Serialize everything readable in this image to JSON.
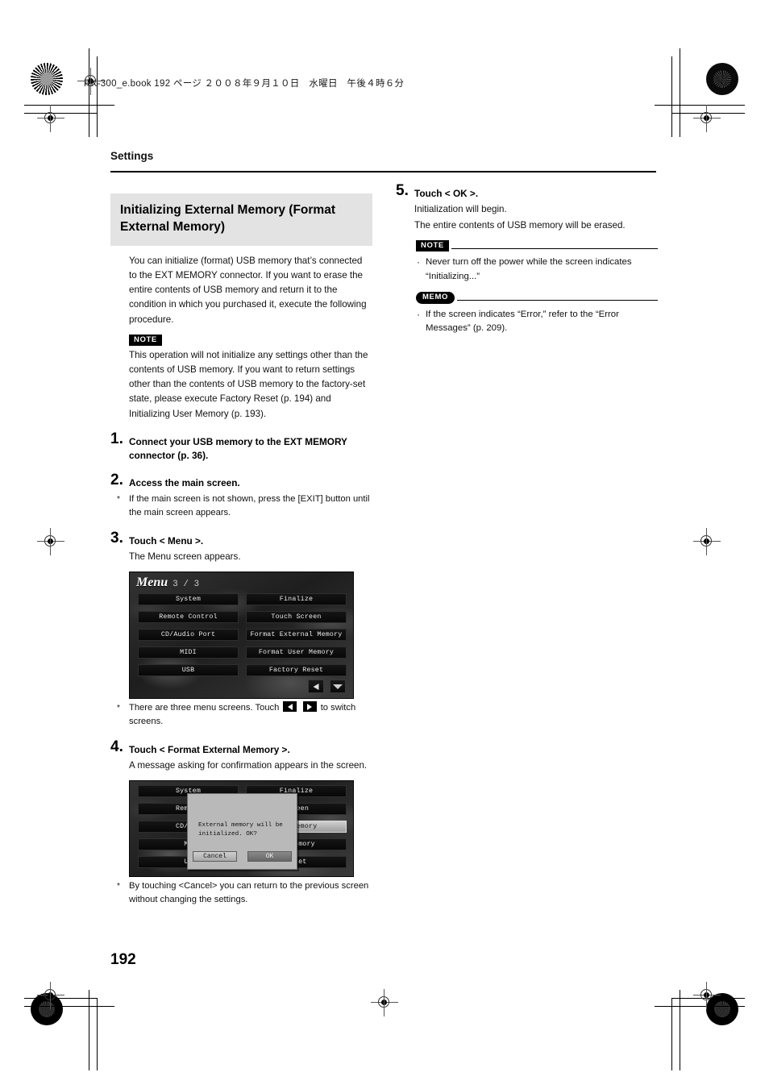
{
  "print": {
    "file_header": "RK-300_e.book  192 ページ  ２００８年９月１０日　水曜日　午後４時６分"
  },
  "page": {
    "running_head": "Settings",
    "folio": "192"
  },
  "left_column": {
    "section_title": "Initializing External Memory (Format External Memory)",
    "intro": "You can initialize (format) USB memory that’s connected to the EXT MEMORY connector. If you want to erase the entire contents of USB memory and return it to the condition in which you purchased it, execute the following procedure.",
    "note_badge": "NOTE",
    "note_text": "This operation will not initialize any settings other than the contents of USB memory. If you want to return settings other than the contents of USB memory to the factory-set state, please execute Factory Reset (p. 194) and Initializing User Memory (p. 193).",
    "steps": [
      {
        "num": "1.",
        "title": "Connect your USB memory to the EXT MEMORY connector (p. 36)."
      },
      {
        "num": "2.",
        "title": "Access the main screen.",
        "aster": "If the main screen is not shown, press the [EXIT] button until the main screen appears."
      },
      {
        "num": "3.",
        "title": "Touch < Menu >.",
        "body": "The Menu screen appears.",
        "aster_pre": "There are three menu screens. Touch",
        "aster_post": "to switch screens."
      },
      {
        "num": "4.",
        "title": "Touch < Format External Memory >.",
        "body": "A message asking for confirmation appears in the screen.",
        "aster": "By touching <Cancel> you can return to the previous screen without changing the settings."
      }
    ]
  },
  "right_column": {
    "step": {
      "num": "5.",
      "title": "Touch < OK >.",
      "body1": "Initialization will begin.",
      "body2": "The entire contents of USB memory will be erased."
    },
    "note_badge": "NOTE",
    "note_bullet": "Never turn off the power while the screen indicates “Initializing...”",
    "memo_badge": "MEMO",
    "memo_bullet": "If the screen indicates “Error,” refer to the “Error Messages” (p. 209)."
  },
  "menu_screen": {
    "title_word": "Menu",
    "title_pages": "3 / 3",
    "left_buttons": [
      "System",
      "Remote Control",
      "CD/Audio Port",
      "MIDI",
      "USB"
    ],
    "right_buttons": [
      "Finalize",
      "Touch Screen",
      "Format External  Memory",
      "Format User Memory",
      "Factory Reset"
    ],
    "nav_prev": "prev-arrow-icon",
    "nav_next": "next-arrow-icon"
  },
  "dialog_screen": {
    "left_buttons": [
      "System",
      "Remote",
      "CD/Auc",
      "MI",
      "US"
    ],
    "right_buttons": [
      "Finalize",
      "Screen",
      "nal  Memory",
      "er Memory",
      "Reset"
    ],
    "message": "External memory will be\ninitialized. OK?",
    "cancel_label": "Cancel",
    "ok_label": "OK"
  }
}
